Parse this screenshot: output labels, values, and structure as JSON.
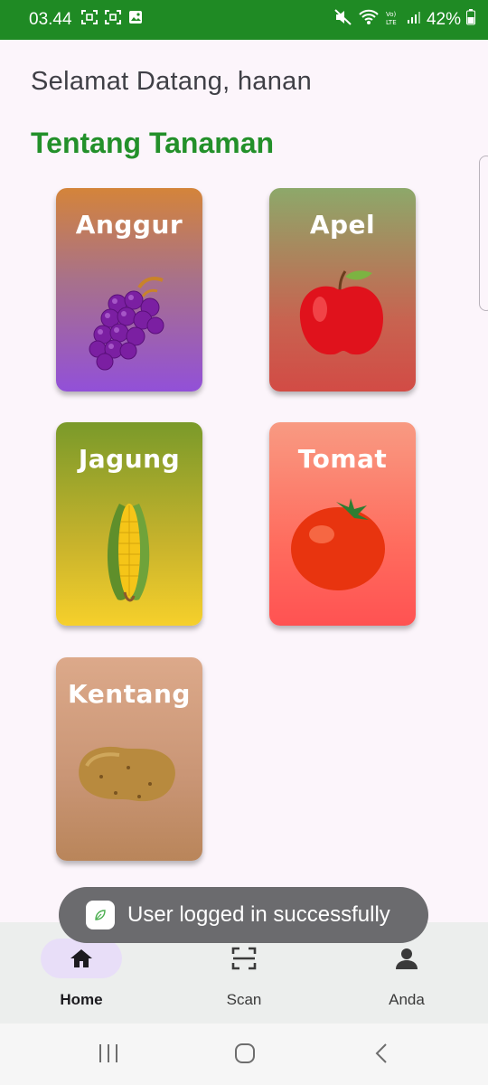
{
  "status_bar": {
    "time": "03.44",
    "battery": "42%",
    "icons": [
      "screenshot-icon",
      "screenshot-icon",
      "gallery-icon",
      "mute-icon",
      "wifi-icon",
      "volte-icon",
      "signal-icon",
      "battery-icon"
    ]
  },
  "header": {
    "welcome": "Selamat Datang, hanan",
    "section_title": "Tentang Tanaman"
  },
  "plants": [
    {
      "name": "Anggur",
      "icon": "grapes-icon"
    },
    {
      "name": "Apel",
      "icon": "apple-icon"
    },
    {
      "name": "Jagung",
      "icon": "corn-icon"
    },
    {
      "name": "Tomat",
      "icon": "tomato-icon"
    },
    {
      "name": "Kentang",
      "icon": "potato-icon"
    }
  ],
  "toast": {
    "message": "User logged in successfully"
  },
  "bottom_nav": {
    "items": [
      {
        "label": "Home",
        "icon": "home-icon",
        "active": true
      },
      {
        "label": "Scan",
        "icon": "scan-icon",
        "active": false
      },
      {
        "label": "Anda",
        "icon": "person-icon",
        "active": false
      }
    ]
  },
  "colors": {
    "status_bar": "#1f8a24",
    "section_title": "#23902a",
    "background": "#fcf5fb",
    "nav_active_pill": "#e8def8"
  }
}
